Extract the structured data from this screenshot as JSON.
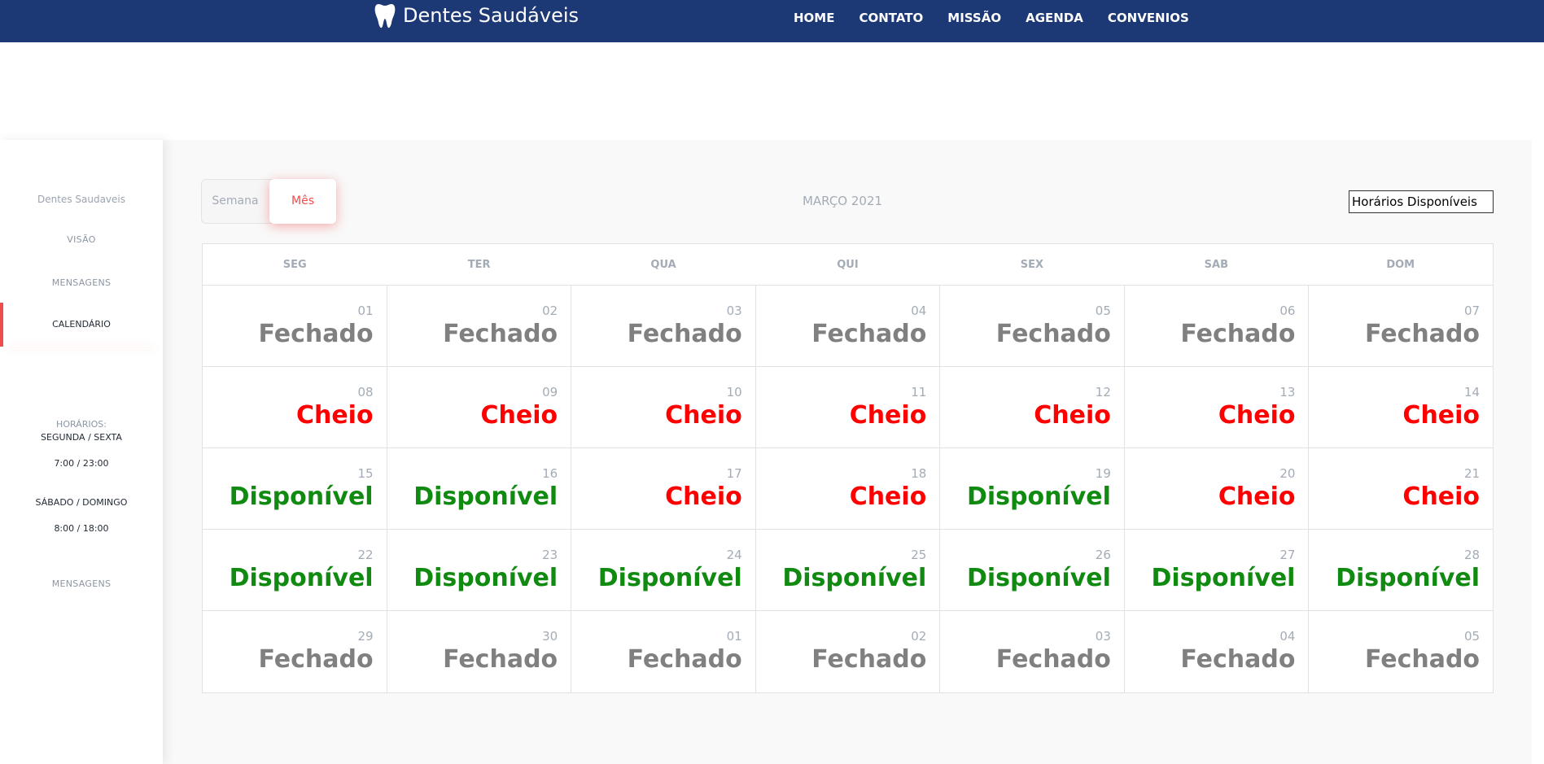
{
  "navbar": {
    "brand": "Dentes Saudáveis",
    "links": [
      "HOME",
      "CONTATO",
      "MISSÃO",
      "AGENDA",
      "CONVENIOS"
    ]
  },
  "sidebar": {
    "brand": "Dentes Saudaveis",
    "visao": "VISÃO",
    "mensagens": "MENSAGENS",
    "calendario": "CALENDÁRIO",
    "hours_title": "HORÁRIOS:",
    "weekdays": "SEGUNDA / SEXTA",
    "weekdays_time": "7:00 / 23:00",
    "weekend": "SÁBADO / DOMINGO",
    "weekend_time": "8:00 / 18:00",
    "mensagens_bottom": "MENSAGENS"
  },
  "toggle": {
    "week": "Semana",
    "month": "Mês",
    "active": "month"
  },
  "month_title": "MARÇO 2021",
  "filter_select": {
    "value": "Horários Disponíveis"
  },
  "calendar": {
    "days": [
      "SEG",
      "TER",
      "QUA",
      "QUI",
      "SEX",
      "SAB",
      "DOM"
    ],
    "weeks": [
      [
        {
          "day": "01",
          "status": "Fechado"
        },
        {
          "day": "02",
          "status": "Fechado"
        },
        {
          "day": "03",
          "status": "Fechado"
        },
        {
          "day": "04",
          "status": "Fechado"
        },
        {
          "day": "05",
          "status": "Fechado"
        },
        {
          "day": "06",
          "status": "Fechado"
        },
        {
          "day": "07",
          "status": "Fechado"
        }
      ],
      [
        {
          "day": "08",
          "status": "Cheio"
        },
        {
          "day": "09",
          "status": "Cheio"
        },
        {
          "day": "10",
          "status": "Cheio"
        },
        {
          "day": "11",
          "status": "Cheio"
        },
        {
          "day": "12",
          "status": "Cheio"
        },
        {
          "day": "13",
          "status": "Cheio"
        },
        {
          "day": "14",
          "status": "Cheio"
        }
      ],
      [
        {
          "day": "15",
          "status": "Disponível"
        },
        {
          "day": "16",
          "status": "Disponível"
        },
        {
          "day": "17",
          "status": "Cheio"
        },
        {
          "day": "18",
          "status": "Cheio"
        },
        {
          "day": "19",
          "status": "Disponível"
        },
        {
          "day": "20",
          "status": "Cheio"
        },
        {
          "day": "21",
          "status": "Cheio"
        }
      ],
      [
        {
          "day": "22",
          "status": "Disponível"
        },
        {
          "day": "23",
          "status": "Disponível"
        },
        {
          "day": "24",
          "status": "Disponível"
        },
        {
          "day": "25",
          "status": "Disponível"
        },
        {
          "day": "26",
          "status": "Disponível"
        },
        {
          "day": "27",
          "status": "Disponível"
        },
        {
          "day": "28",
          "status": "Disponível"
        }
      ],
      [
        {
          "day": "29",
          "status": "Fechado"
        },
        {
          "day": "30",
          "status": "Fechado"
        },
        {
          "day": "01",
          "status": "Fechado"
        },
        {
          "day": "02",
          "status": "Fechado"
        },
        {
          "day": "03",
          "status": "Fechado"
        },
        {
          "day": "04",
          "status": "Fechado"
        },
        {
          "day": "05",
          "status": "Fechado"
        }
      ]
    ]
  },
  "colors": {
    "navbar": "#1c3875",
    "accent": "#ef4d4d",
    "fechado": "#808080",
    "cheio": "#ff0000",
    "disponivel": "#118a11"
  }
}
